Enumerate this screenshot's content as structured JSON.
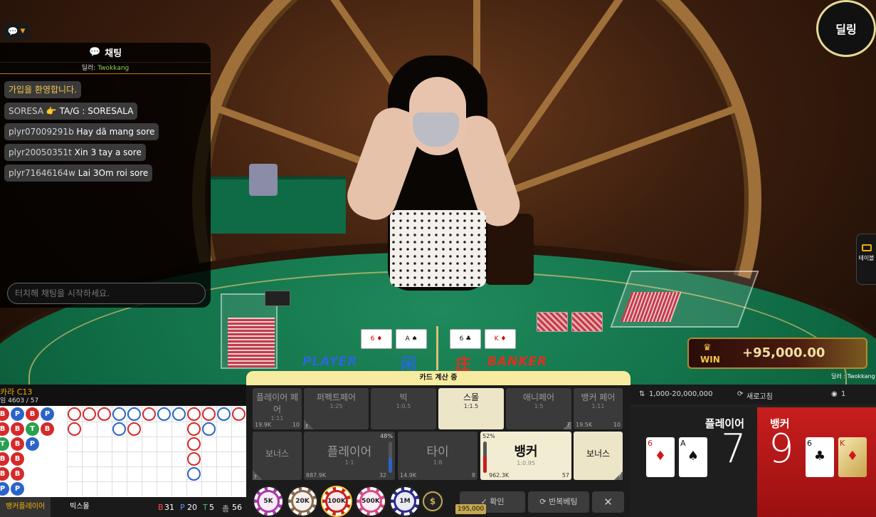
{
  "chat": {
    "title": "채팅",
    "dealer_label": "딜러:",
    "dealer_name": "Twokkang",
    "messages": [
      {
        "user": "",
        "text": "가입을 환영합니다.",
        "system": true
      },
      {
        "user": "SORESA",
        "text": "👉 TA/G : SORESALA"
      },
      {
        "user": "plyr07009291b",
        "text": "Hay dã mang sore"
      },
      {
        "user": "plyr20050351t",
        "text": "Xin 3 tay a sore"
      },
      {
        "user": "plyr71646164w",
        "text": "Lai 3Om roi sore"
      }
    ],
    "input_placeholder": "터치해 채팅을 시작하세요."
  },
  "deal_button": "딜링",
  "side_tab": "테이블",
  "felt": {
    "player": "PLAYER",
    "player_han": "闲",
    "banker": "BANKER",
    "banker_han": "庄"
  },
  "win": {
    "label": "WIN",
    "amount": "+95,000.00"
  },
  "dealer_note": "딜러 : Twokkang",
  "road": {
    "title": "카라 C13",
    "subtitle": "임 4603 / 57",
    "tabs": [
      "뱅커플레이어",
      "빅스몰"
    ],
    "beads": [
      [
        "B",
        "B",
        "T",
        "B",
        "B",
        "P"
      ],
      [
        "P",
        "B",
        "B",
        "B",
        "B",
        "P"
      ],
      [
        "B",
        "T",
        "P",
        "",
        "",
        ""
      ],
      [
        "P",
        "B",
        "",
        "",
        "",
        ""
      ]
    ],
    "stats": {
      "B": "31",
      "P": "20",
      "T": "5",
      "total_label": "총",
      "total": "56"
    }
  },
  "bet": {
    "status": "카드 계산 중",
    "side_bets": [
      {
        "name": "플레이어 페어",
        "odds": "1:11",
        "amount": "19.9K",
        "players": "10"
      },
      {
        "name": "퍼펙트페어",
        "odds": "1:25",
        "amount": "",
        "players": ""
      },
      {
        "name": "빅",
        "odds": "1:0.5",
        "amount": "",
        "players": ""
      },
      {
        "name": "스몰",
        "odds": "1:1.5",
        "amount": "",
        "players": ""
      },
      {
        "name": "애니페어",
        "odds": "1:5",
        "amount": "",
        "players": ""
      },
      {
        "name": "뱅커 페어",
        "odds": "1:11",
        "amount": "19.5K",
        "players": "10"
      }
    ],
    "main": {
      "player_bonus": "보너스",
      "player": {
        "name": "플레이어",
        "odds": "1:1",
        "amount": "887.9K",
        "players": "32",
        "pct": "48%"
      },
      "tie": {
        "name": "타이",
        "odds": "1:8",
        "amount": "14.9K",
        "players": "8"
      },
      "banker": {
        "name": "뱅커",
        "odds": "1:0.95",
        "amount": "962.3K",
        "players": "57",
        "pct": "52%"
      },
      "banker_bonus": "보너스"
    },
    "chips": [
      "5K",
      "20K",
      "100K",
      "500K",
      "1M"
    ],
    "confirm": "확인",
    "repeat": "반복베팅",
    "close": "✕",
    "balance": "195,000"
  },
  "info": {
    "limits": "1,000-20,000,000",
    "refresh": "새로고침",
    "viewers": "1"
  },
  "result": {
    "player_label": "플레이어",
    "player_score": "7",
    "banker_label": "뱅커",
    "banker_score": "9"
  },
  "colors": {
    "banker": "#c81e1e",
    "player": "#2a64c8",
    "tie": "#2aa050",
    "accent": "#f2b000"
  }
}
